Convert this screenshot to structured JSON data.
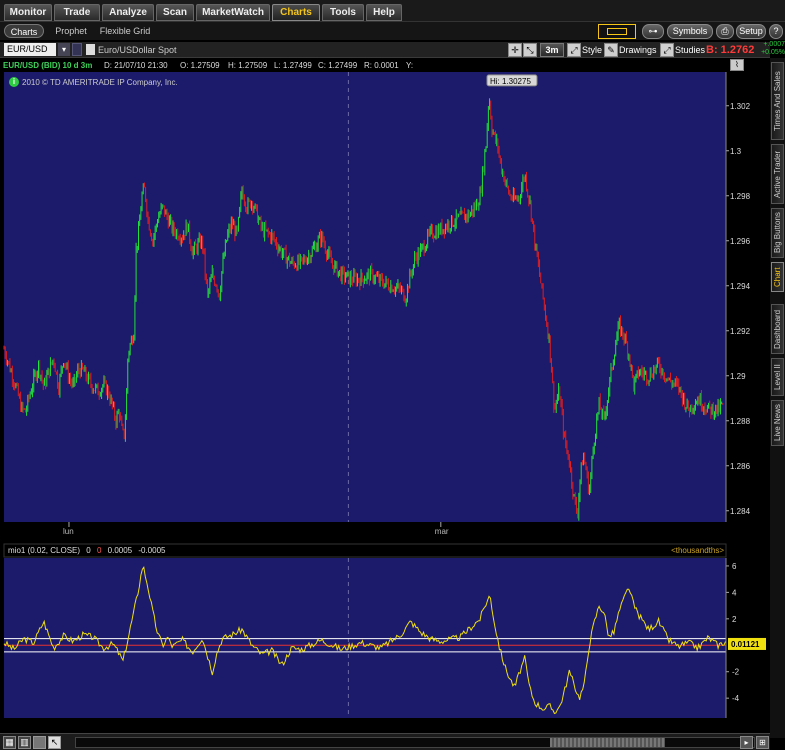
{
  "nav_tabs": [
    "Monitor",
    "Trade",
    "Analyze",
    "Scan",
    "MarketWatch",
    "Charts",
    "Tools",
    "Help"
  ],
  "active_nav": "Charts",
  "sub_tabs": [
    "Charts",
    "Prophet",
    "Flexible Grid"
  ],
  "header_right": {
    "symbols_label": "Symbols",
    "setup_label": "Setup"
  },
  "toolbar": {
    "symbol": "EUR/USD",
    "description": "Euro/USDollar Spot",
    "timeframe": "3m",
    "style_label": "Style",
    "drawings_label": "Drawings",
    "studies_label": "Studies",
    "bid_label": "B: 1.2762",
    "change_up": "+.0007",
    "change_pct": "+0.05%"
  },
  "infobar": {
    "symbol_spec": "EUR/USD (BID) 10 d 3m",
    "date": "D: 21/07/10 21:30",
    "open": "O: 1.27509",
    "high": "H: 1.27509",
    "low": "L: 1.27499",
    "close": "C: 1.27499",
    "range": "R: 0.0001",
    "y": "Y:"
  },
  "copyright": "2010 © TD AMERITRADE IP Company, Inc.",
  "price_axis_labels": [
    "1.302",
    "1.3",
    "1.298",
    "1.296",
    "1.294",
    "1.292",
    "1.29",
    "1.288",
    "1.286",
    "1.284"
  ],
  "time_axis_labels": [
    "lun",
    "mar"
  ],
  "hi_label": "Hi: 1.30275",
  "study": {
    "title": "mio1 (0.02, CLOSE)",
    "p1": "0",
    "p2": "0",
    "p3": "0.0005",
    "p4": "-0.0005",
    "unit": "<thousandths>",
    "current_value": "0.01121",
    "axis_labels": [
      "6",
      "4",
      "2",
      "-2",
      "-4"
    ]
  },
  "side_tabs": [
    "Times And Sales",
    "Active Trader",
    "Big Buttons",
    "Chart",
    "Dashboard",
    "Level II",
    "Live News"
  ],
  "active_side_tab": "Chart",
  "colors": {
    "plot_bg": "#1b1a6b",
    "up_candle": "#22e33a",
    "down_candle": "#e51d1d",
    "oscillator": "#f0e010",
    "zero_line": "#e83030",
    "band_line": "#ffffff",
    "accent": "#f5c518"
  },
  "chart_data": [
    {
      "type": "line",
      "title": "",
      "xlabel": "",
      "ylabel": "",
      "ylim": [
        1.2835,
        1.3035
      ],
      "x": [
        0,
        12,
        18,
        22,
        25,
        30,
        35,
        40,
        45,
        50,
        55,
        60,
        65,
        70,
        75,
        80,
        85,
        90,
        95,
        100,
        105,
        110,
        113,
        116,
        119,
        121,
        123,
        125,
        128,
        131,
        133,
        136,
        139,
        142,
        145,
        150,
        155,
        160,
        170,
        180,
        185,
        190,
        195,
        200,
        205,
        210,
        215,
        217,
        220,
        225,
        230,
        235,
        240,
        245,
        250,
        260,
        270,
        280,
        290,
        300,
        310,
        320,
        330,
        340,
        350,
        360,
        370,
        380,
        390,
        400,
        405,
        410,
        415,
        420,
        430,
        440,
        450,
        460,
        470,
        475,
        480,
        483,
        486,
        489,
        492,
        495,
        498,
        500,
        505,
        510,
        515,
        520,
        525,
        528,
        531,
        535,
        540,
        545,
        550,
        555,
        560,
        565,
        570,
        575,
        578,
        581,
        584,
        587,
        590,
        595,
        600,
        605,
        610,
        615,
        620,
        625,
        630,
        635,
        640,
        650,
        660,
        670,
        680,
        690,
        700,
        710,
        720,
        725
      ],
      "y": [
        1.2912,
        1.2895,
        1.2885,
        1.2884,
        1.289,
        1.2898,
        1.2905,
        1.2895,
        1.2902,
        1.2908,
        1.2895,
        1.2908,
        1.29,
        1.2895,
        1.2903,
        1.2902,
        1.2898,
        1.2895,
        1.2893,
        1.2896,
        1.2893,
        1.2885,
        1.288,
        1.2885,
        1.2875,
        1.2873,
        1.2885,
        1.291,
        1.2915,
        1.292,
        1.2955,
        1.2965,
        1.298,
        1.2983,
        1.297,
        1.296,
        1.297,
        1.2975,
        1.2965,
        1.2962,
        1.2967,
        1.2955,
        1.2958,
        1.296,
        1.2935,
        1.2945,
        1.294,
        1.2935,
        1.2948,
        1.2962,
        1.2968,
        1.2962,
        1.2983,
        1.2975,
        1.2978,
        1.2965,
        1.2962,
        1.2955,
        1.295,
        1.295,
        1.2955,
        1.2962,
        1.295,
        1.2945,
        1.2943,
        1.2943,
        1.2945,
        1.2942,
        1.294,
        1.2938,
        1.2935,
        1.2945,
        1.2953,
        1.2955,
        1.2963,
        1.2965,
        1.2968,
        1.297,
        1.2972,
        1.2975,
        1.298,
        1.2992,
        1.3003,
        1.3025,
        1.301,
        1.3005,
        1.3002,
        1.2995,
        1.2987,
        1.298,
        1.2978,
        1.298,
        1.299,
        1.2982,
        1.2975,
        1.296,
        1.2945,
        1.293,
        1.2915,
        1.2885,
        1.2893,
        1.2872,
        1.2862,
        1.2845,
        1.2838,
        1.2855,
        1.2865,
        1.2858,
        1.2848,
        1.2872,
        1.2887,
        1.288,
        1.2895,
        1.291,
        1.2922,
        1.2918,
        1.291,
        1.2895,
        1.2902,
        1.29,
        1.2905,
        1.2898,
        1.2895,
        1.2885,
        1.289,
        1.2885,
        1.2885,
        1.2887
      ]
    },
    {
      "type": "line",
      "title": "mio1 (0.02, CLOSE)",
      "xlabel": "",
      "ylabel": "<thousandths>",
      "ylim": [
        -5.5,
        6.6
      ],
      "x": [
        0,
        10,
        20,
        30,
        40,
        50,
        60,
        70,
        80,
        90,
        100,
        110,
        115,
        120,
        125,
        130,
        135,
        140,
        145,
        150,
        155,
        160,
        165,
        170,
        180,
        190,
        200,
        210,
        215,
        220,
        230,
        240,
        250,
        260,
        270,
        280,
        290,
        300,
        320,
        340,
        360,
        380,
        400,
        410,
        420,
        430,
        440,
        460,
        480,
        485,
        490,
        495,
        500,
        505,
        510,
        515,
        520,
        525,
        530,
        535,
        540,
        545,
        550,
        555,
        560,
        565,
        570,
        575,
        580,
        585,
        590,
        595,
        600,
        605,
        610,
        615,
        620,
        625,
        630,
        635,
        640,
        650,
        660,
        670,
        680,
        690,
        700,
        710,
        720,
        728
      ],
      "y": [
        0.2,
        -0.3,
        0.5,
        0.2,
        1.8,
        -0.2,
        0.7,
        0.3,
        0.8,
        0.6,
        -0.2,
        0.1,
        -0.5,
        -1.2,
        0.5,
        2.2,
        4.0,
        6.1,
        4.5,
        2.5,
        0.9,
        0.0,
        0.6,
        -0.1,
        0.4,
        -0.5,
        0.6,
        -2.0,
        -0.5,
        0.5,
        0.8,
        1.2,
        0.0,
        -0.7,
        -0.4,
        -1.5,
        -0.2,
        -0.3,
        0.4,
        -0.3,
        0.2,
        -0.2,
        0.8,
        1.8,
        1.0,
        0.5,
        0.3,
        0.6,
        2.0,
        3.0,
        3.8,
        1.5,
        -0.3,
        -1.6,
        -2.5,
        -3.2,
        -2.0,
        -1.0,
        -3.2,
        -4.3,
        -4.6,
        -4.8,
        -4.6,
        -5.0,
        -4.7,
        -3.5,
        -2.0,
        -3.0,
        -4.0,
        -3.0,
        0.0,
        1.7,
        3.0,
        2.5,
        0.6,
        1.0,
        2.5,
        3.5,
        4.4,
        3.0,
        2.3,
        1.2,
        1.8,
        0.4,
        -0.1,
        0.2,
        -0.2,
        0.6,
        0.0,
        0.3
      ]
    }
  ]
}
